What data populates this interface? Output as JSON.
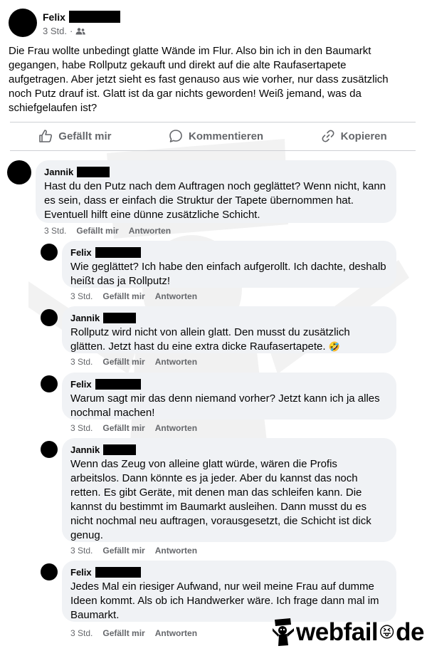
{
  "post": {
    "author": "Felix",
    "time": "3 Std.",
    "separator": "·",
    "audience_icon": "friends-icon",
    "text": "Die Frau wollte unbedingt glatte Wände im Flur. Also bin ich in den Baumarkt gegangen, habe Rollputz gekauft und direkt auf die alte Raufasertapete aufgetragen. Aber jetzt sieht es fast genauso aus wie vorher, nur dass zusätzlich noch Putz drauf ist. Glatt ist da gar nichts geworden! Weiß jemand, was da schiefgelaufen ist?"
  },
  "actions": {
    "like": "Gefällt mir",
    "comment": "Kommentieren",
    "copy": "Kopieren"
  },
  "comments": [
    {
      "author": "Jannik",
      "text": "Hast du den Putz nach dem Auftragen noch geglättet? Wenn nicht, kann es sein, dass er einfach die Struktur der Tapete übernommen hat. Eventuell hilft eine dünne zusätzliche Schicht.",
      "time": "3 Std.",
      "like": "Gefällt mir",
      "reply": "Antworten"
    },
    {
      "author": "Felix",
      "text": "Wie geglättet? Ich habe den einfach aufgerollt. Ich dachte, deshalb heißt das ja Rollputz!",
      "time": "3 Std.",
      "like": "Gefällt mir",
      "reply": "Antworten"
    },
    {
      "author": "Jannik",
      "text": "Rollputz wird nicht von allein glatt. Den musst du zusätzlich glätten. Jetzt hast du eine extra dicke Raufasertapete.",
      "emoji": "🤣",
      "time": "3 Std.",
      "like": "Gefällt mir",
      "reply": "Antworten"
    },
    {
      "author": "Felix",
      "text": "Warum sagt mir das denn niemand vorher? Jetzt kann ich ja alles nochmal machen!",
      "time": "3 Std.",
      "like": "Gefällt mir",
      "reply": "Antworten"
    },
    {
      "author": "Jannik",
      "text": "Wenn das Zeug von alleine glatt würde, wären die Profis arbeitslos. Dann könnte es ja jeder. Aber du kannst das noch retten. Es gibt Geräte, mit denen man das schleifen kann. Die kannst du bestimmt im Baumarkt ausleihen. Dann musst du es nicht nochmal neu auftragen, vorausgesetzt, die Schicht ist dick genug.",
      "time": "3 Std.",
      "like": "Gefällt mir",
      "reply": "Antworten"
    },
    {
      "author": "Felix",
      "text": "Jedes Mal ein riesiger Aufwand, nur weil meine Frau auf dumme Ideen kommt. Als ob ich Handwerker wäre. Ich frage dann mal im Baumarkt.",
      "time": "3 Std.",
      "like": "Gefällt mir",
      "reply": "Antworten"
    }
  ],
  "logo": {
    "text": "webfail",
    "emoji": "😝",
    "suffix": "de"
  }
}
